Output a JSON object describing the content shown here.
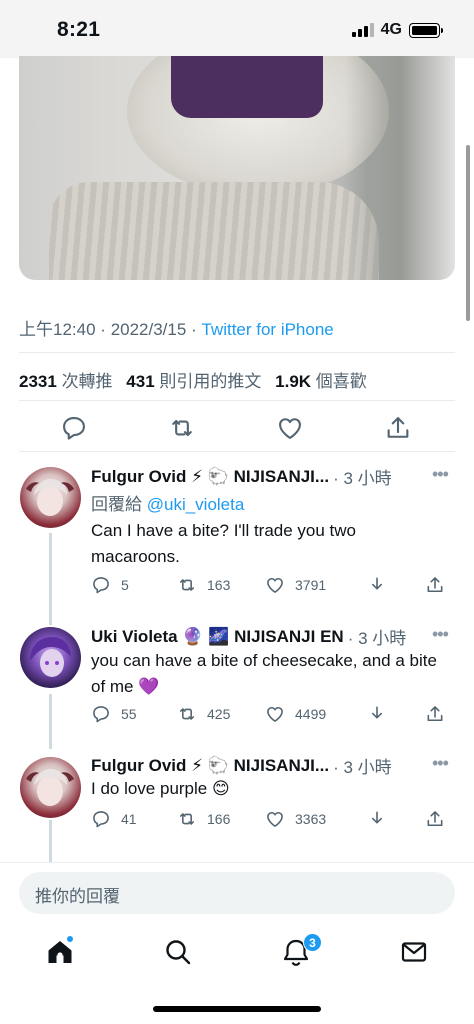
{
  "status_bar": {
    "time": "8:21",
    "network": "4G"
  },
  "tweet": {
    "timestamp": "上午12:40",
    "date": "2022/3/15",
    "separator": "·",
    "source": "Twitter for iPhone",
    "stats": {
      "retweets_count": "2331",
      "retweets_label": "次轉推",
      "quotes_count": "431",
      "quotes_label": "則引用的推文",
      "likes_count": "1.9K",
      "likes_label": "個喜歡"
    },
    "actions": [
      "reply-icon",
      "retweet-icon",
      "like-icon",
      "share-icon"
    ]
  },
  "replies": [
    {
      "name": "Fulgur Ovid ⚡ 🐑 NIJISANJI...",
      "time": "· 3 小時",
      "reply_to_prefix": "回覆給",
      "reply_to": "@uki_violeta",
      "text": "Can I have a bite? I'll trade you two macaroons.",
      "replies": "5",
      "retweets": "163",
      "likes": "3791"
    },
    {
      "name": "Uki Violeta 🔮 🌌 NIJISANJI EN",
      "time": "· 3 小時",
      "text": "you can have a bite of cheesecake, and a bite of me 💜",
      "replies": "55",
      "retweets": "425",
      "likes": "4499"
    },
    {
      "name": "Fulgur Ovid ⚡ 🐑 NIJISANJI...",
      "time": "· 3 小時",
      "text": "I do love purple 😊",
      "replies": "41",
      "retweets": "166",
      "likes": "3363"
    }
  ],
  "compose": {
    "placeholder": "推你的回覆"
  },
  "tabbar": {
    "items": [
      "home-icon",
      "search-icon",
      "notifications-icon",
      "messages-icon"
    ],
    "notification_count": "3"
  },
  "colors": {
    "accent": "#1d9bf0",
    "text": "#0f1419",
    "muted": "#536471"
  }
}
